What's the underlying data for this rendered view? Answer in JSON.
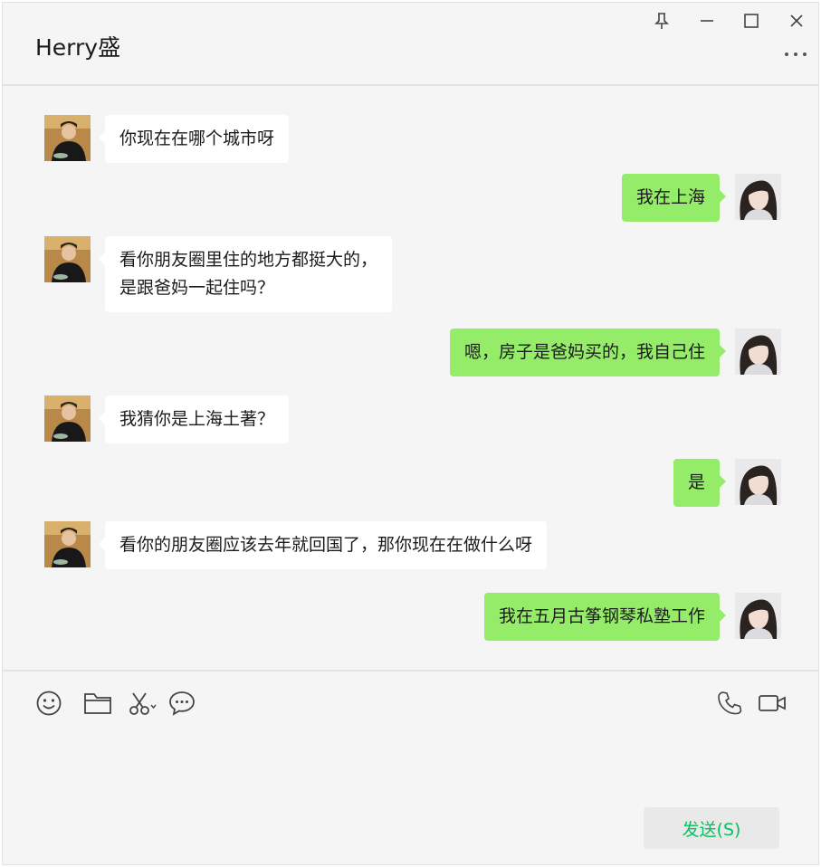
{
  "header": {
    "title": "Herry盛"
  },
  "messages": [
    {
      "side": "in",
      "lines": [
        "你现在在哪个城市呀"
      ]
    },
    {
      "side": "out",
      "lines": [
        "我在上海"
      ]
    },
    {
      "side": "in",
      "lines": [
        "看你朋友圈里住的地方都挺大的，",
        "是跟爸妈一起住吗？"
      ]
    },
    {
      "side": "out",
      "lines": [
        "嗯，房子是爸妈买的，我自己住"
      ]
    },
    {
      "side": "in",
      "lines": [
        "我猜你是上海土著？"
      ]
    },
    {
      "side": "out",
      "lines": [
        "是"
      ]
    },
    {
      "side": "in",
      "lines": [
        "看你的朋友圈应该去年就回国了，那你现在在做什么呀"
      ]
    },
    {
      "side": "out",
      "lines": [
        "我在五月古筝钢琴私塾工作"
      ]
    }
  ],
  "composer": {
    "send_label": "发送(S)"
  },
  "colors": {
    "outgoing_bubble": "#95ec69",
    "incoming_bubble": "#ffffff",
    "send_text": "#07c160",
    "background": "#f5f5f5"
  }
}
